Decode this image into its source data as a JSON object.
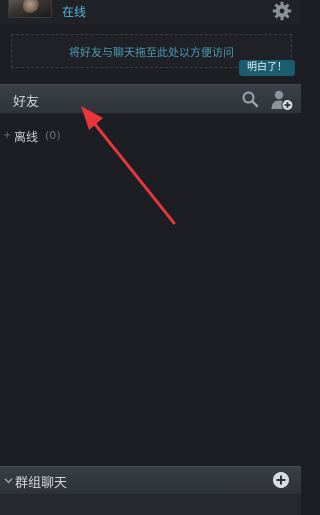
{
  "header": {
    "status": "在线",
    "icons": {
      "avatar": "avatar-photo",
      "settings": "gear-icon"
    }
  },
  "dropzone": {
    "hint": "将好友与聊天拖至此处以方便访问",
    "dismiss_label": "明白了！"
  },
  "friends": {
    "title": "好友",
    "icons": {
      "search": "search-icon",
      "add_friend": "add-friend-icon"
    },
    "groups": [
      {
        "label": "离线",
        "count": "(0)"
      }
    ]
  },
  "group_chat": {
    "title": "群组聊天",
    "icons": {
      "collapse": "chevron-down-icon",
      "add": "plus-circle-icon"
    }
  },
  "colors": {
    "background": "#1c1e23",
    "accent": "#4eb6da",
    "button": "#1b5d6e",
    "annotation_arrow": "#e8373a"
  }
}
